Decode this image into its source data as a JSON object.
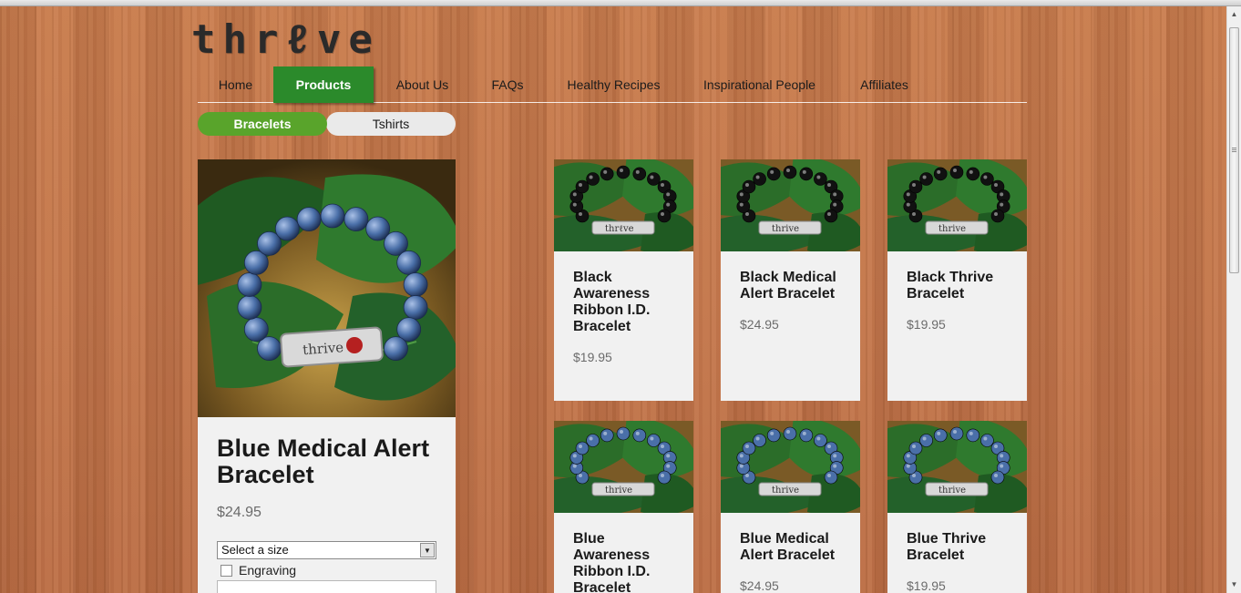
{
  "brand": {
    "logo_text": "thr",
    "logo_ribbon": "ℓ",
    "logo_rest": "ve"
  },
  "nav": {
    "items": [
      {
        "label": "Home",
        "active": false
      },
      {
        "label": "Products",
        "active": true
      },
      {
        "label": "About Us",
        "active": false
      },
      {
        "label": "FAQs",
        "active": false
      },
      {
        "label": "Healthy Recipes",
        "active": false
      },
      {
        "label": "Inspirational People",
        "active": false
      },
      {
        "label": "Affiliates",
        "active": false
      }
    ]
  },
  "subnav": {
    "items": [
      {
        "label": "Bracelets",
        "active": true
      },
      {
        "label": "Tshirts",
        "active": false
      }
    ]
  },
  "featured": {
    "title": "Blue Medical Alert Bracelet",
    "price": "$24.95",
    "size_select": "Select a size",
    "engraving_label": "Engraving",
    "bead_color": "#4a6fa8"
  },
  "products": [
    {
      "title": "Black Awareness Ribbon I.D. Bracelet",
      "price": "$19.95",
      "bead_color": "#111111",
      "plate_text": "thrℓve"
    },
    {
      "title": "Black Medical Alert Bracelet",
      "price": "$24.95",
      "bead_color": "#111111",
      "plate_text": "thrive"
    },
    {
      "title": "Black Thrive Bracelet",
      "price": "$19.95",
      "bead_color": "#111111",
      "plate_text": "thrive"
    },
    {
      "title": "Blue Awareness Ribbon I.D. Bracelet",
      "price": "",
      "bead_color": "#4a6fa8",
      "plate_text": "thrive"
    },
    {
      "title": "Blue Medical Alert Bracelet",
      "price": "$24.95",
      "bead_color": "#4a6fa8",
      "plate_text": "thrive"
    },
    {
      "title": "Blue Thrive Bracelet",
      "price": "$19.95",
      "bead_color": "#4a6fa8",
      "plate_text": "thrive"
    }
  ],
  "colors": {
    "nav_active": "#2b8a2b",
    "pill_active": "#59a42b",
    "card_bg": "#f1f1f1",
    "leaf": "#2f6b2b"
  }
}
